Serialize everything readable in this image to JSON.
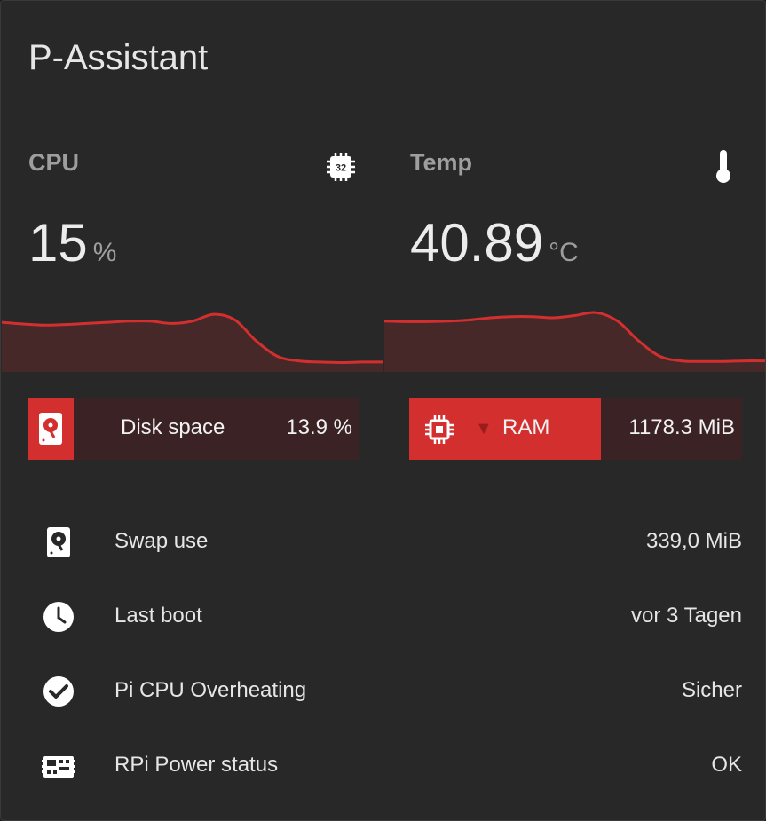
{
  "card": {
    "title": "P-Assistant"
  },
  "cpu": {
    "label": "CPU",
    "value": "15",
    "unit": "%",
    "icon": "chip-32-icon",
    "history": [
      0.22,
      0.25,
      0.27,
      0.26,
      0.24,
      0.22,
      0.2,
      0.2,
      0.24,
      0.2,
      0.08,
      0.18,
      0.55,
      0.82,
      0.9,
      0.92,
      0.93,
      0.92,
      0.92
    ]
  },
  "temp": {
    "label": "Temp",
    "value": "40.89",
    "unit": "°C",
    "icon": "thermometer-icon",
    "history": [
      0.2,
      0.21,
      0.21,
      0.2,
      0.18,
      0.14,
      0.12,
      0.12,
      0.14,
      0.1,
      0.05,
      0.2,
      0.55,
      0.82,
      0.9,
      0.91,
      0.91,
      0.9,
      0.9
    ]
  },
  "disk_bar": {
    "label": "Disk space",
    "value": "13.9 %",
    "percent": 13.9,
    "icon": "harddisk-icon"
  },
  "ram_bar": {
    "label": "RAM",
    "value": "1178.3 MiB",
    "percent": 58,
    "icon": "memory-chip-icon",
    "trend": "▼"
  },
  "rows": [
    {
      "name": "Swap use",
      "value": "339,0 MiB",
      "icon": "harddisk-icon"
    },
    {
      "name": "Last boot",
      "value": "vor 3 Tagen",
      "icon": "clock-icon"
    },
    {
      "name": "Pi CPU Overheating",
      "value": "Sicher",
      "icon": "check-circle-icon"
    },
    {
      "name": "RPi Power status",
      "value": "OK",
      "icon": "raspberry-pi-board-icon"
    }
  ],
  "colors": {
    "accent": "#d32f2f",
    "card": "#282828",
    "bar_bg": "#3b2224"
  }
}
